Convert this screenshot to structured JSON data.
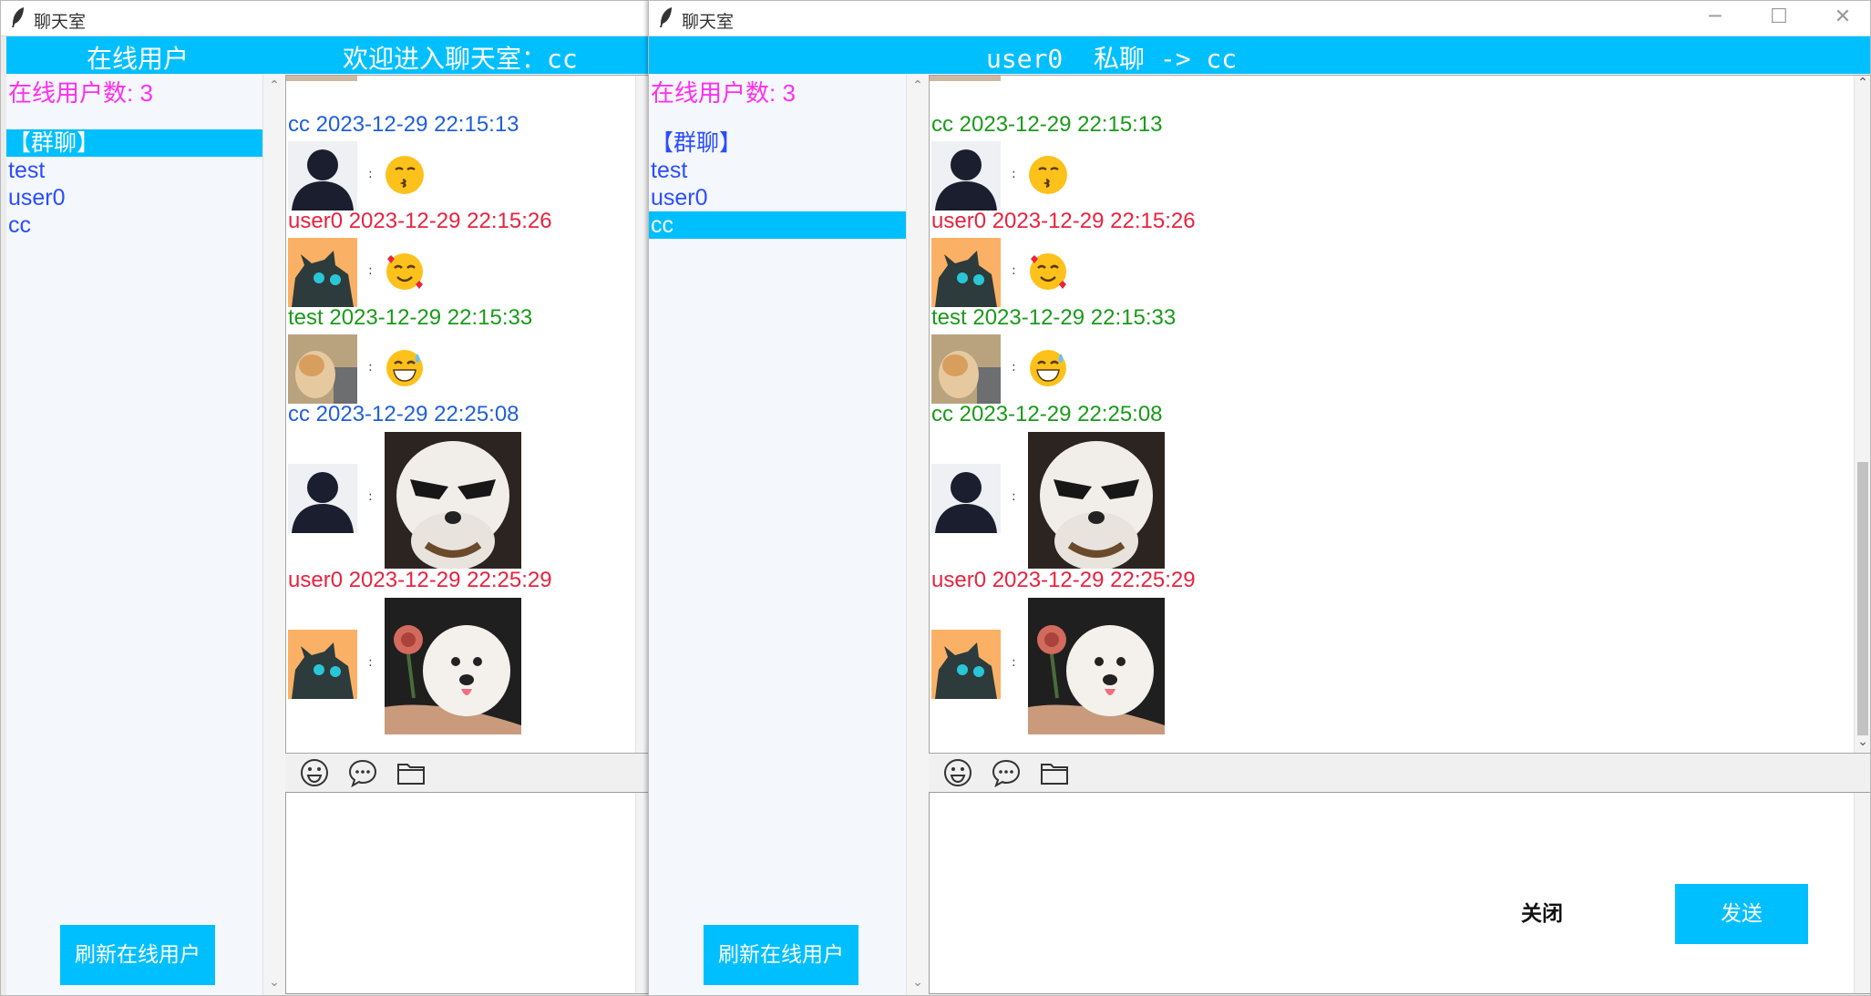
{
  "colors": {
    "accent": "#00bfff",
    "count_text": "#ff2ef0",
    "user_link": "#2a4dff",
    "cc_blue": "#1f5fd6",
    "user0_red": "#e8233f",
    "test_green": "#1a9a1a"
  },
  "window_a": {
    "title": "聊天室",
    "header_left": "在线用户",
    "header_right": "欢迎进入聊天室：cc",
    "online_count": "在线用户数: 3",
    "users": [
      "【群聊】",
      "test",
      "user0",
      "cc"
    ],
    "selected_user_index": 0,
    "refresh_label": "刷新在线用户",
    "messages": [
      {
        "header": "cc 2023-12-29 22:15:13",
        "content": "emoji-kiss"
      },
      {
        "header": "user0 2023-12-29 22:15:26",
        "content": "emoji-hearts"
      },
      {
        "header": "test 2023-12-29 22:15:33",
        "content": "emoji-sweat"
      },
      {
        "header": "cc 2023-12-29 22:25:08",
        "content": "photo-dog-sunglasses"
      },
      {
        "header": "user0 2023-12-29 22:25:29",
        "content": "photo-dog-rose"
      }
    ],
    "colon": ":"
  },
  "window_b": {
    "title": "聊天室",
    "header": "user0  私聊 -> cc",
    "online_count": "在线用户数: 3",
    "users": [
      "【群聊】",
      "test",
      "user0",
      "cc"
    ],
    "selected_user_index": 3,
    "refresh_label": "刷新在线用户",
    "messages": [
      {
        "header": "cc 2023-12-29 22:15:13",
        "content": "emoji-kiss"
      },
      {
        "header": "user0 2023-12-29 22:15:26",
        "content": "emoji-hearts"
      },
      {
        "header": "test 2023-12-29 22:15:33",
        "content": "emoji-sweat"
      },
      {
        "header": "cc 2023-12-29 22:25:08",
        "content": "photo-dog-sunglasses"
      },
      {
        "header": "user0 2023-12-29 22:25:29",
        "content": "photo-dog-rose"
      }
    ],
    "colon": ":",
    "close_label": "关闭",
    "send_label": "发送"
  }
}
